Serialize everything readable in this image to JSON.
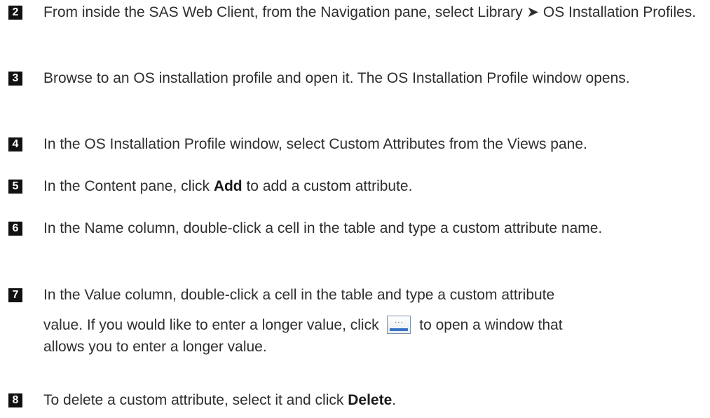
{
  "steps": [
    {
      "number": "2",
      "text_before": "From inside the SAS Web Client, from the Navigation pane, select Library ➤ OS Installation Profiles."
    },
    {
      "number": "3",
      "text_before": "Browse to an OS installation profile and open it. The OS Installation Profile window opens."
    },
    {
      "number": "4",
      "text_before": "In the OS Installation Profile window, select Custom Attributes from the Views pane."
    },
    {
      "number": "5",
      "text_before": "In the Content pane, click ",
      "bold": "Add",
      "text_after": " to add a custom attribute."
    },
    {
      "number": "6",
      "text_before": "In the Name column, double-click a cell in the table and type a custom attribute name."
    },
    {
      "number": "7",
      "line1": "In the Value column, double-click a cell in the table and type a custom attribute",
      "line2_before": "value. If you would like to enter a longer value, click ",
      "button_icon": "ellipsis-button-icon",
      "line2_after": " to open a window that",
      "line3": "allows you to enter a longer value."
    },
    {
      "number": "8",
      "text_before": "To delete a custom attribute, select it and click ",
      "bold": "Delete",
      "text_after": "."
    }
  ]
}
